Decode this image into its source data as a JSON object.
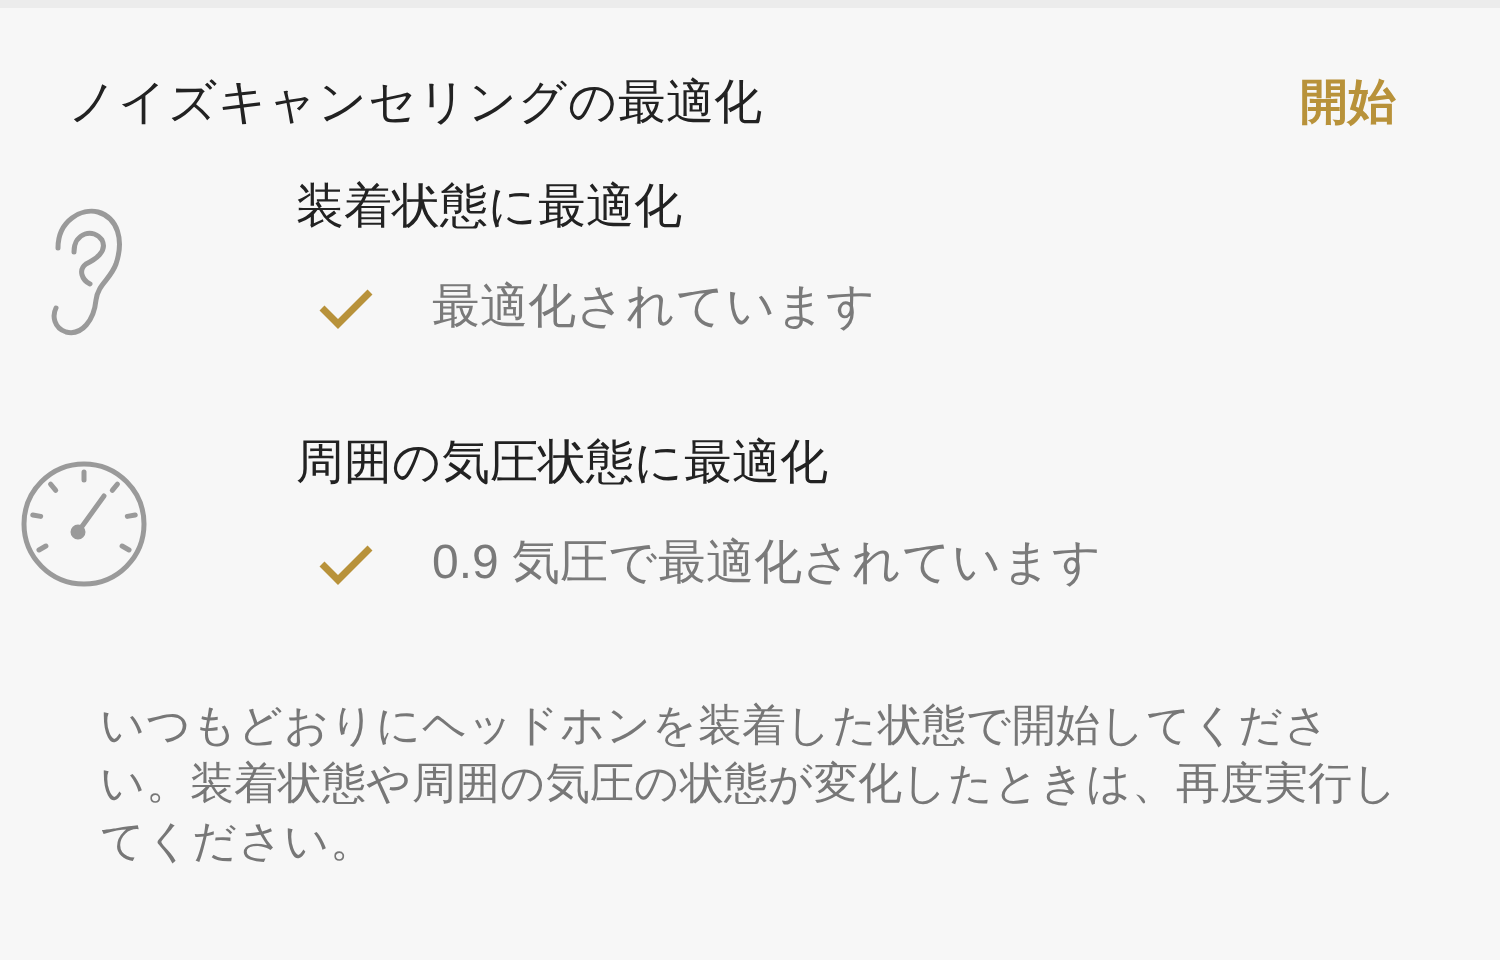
{
  "header": {
    "title": "ノイズキャンセリングの最適化",
    "action": "開始"
  },
  "items": [
    {
      "kind": "ear",
      "title": "装着状態に最適化",
      "status": "最適化されています",
      "checked": true
    },
    {
      "kind": "gauge",
      "title": "周囲の気圧状態に最適化",
      "status": "0.9 気圧で最適化されています",
      "checked": true
    }
  ],
  "note": "いつもどおりにヘッドホンを装着した状態で開始してください。装着状態や周囲の気圧の状態が変化したときは、再度実行してください。"
}
